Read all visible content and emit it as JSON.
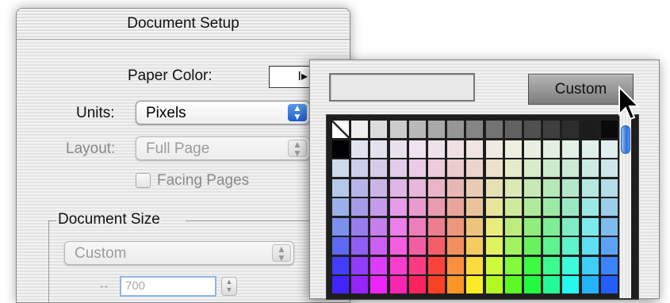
{
  "document_setup": {
    "title": "Document Setup",
    "paper_color_label": "Paper Color:",
    "paper_color_arrow": "I▸",
    "units_label": "Units:",
    "units_value": "Pixels",
    "layout_label": "Layout:",
    "layout_value": "Full Page",
    "facing_pages_label": "Facing Pages",
    "document_size_label": "Document Size",
    "size_preset_value": "Custom",
    "width_value": "700"
  },
  "palette": {
    "custom_button_label": "Custom",
    "selected_color": "#ffffff"
  },
  "colors": {
    "accent_blue": "#2b70d8",
    "palette_border": "#1e1e1e"
  }
}
